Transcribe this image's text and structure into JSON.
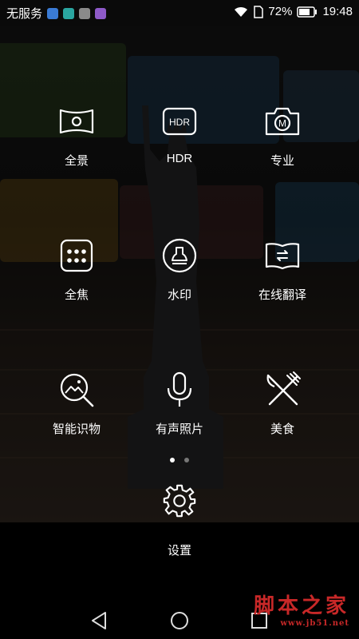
{
  "status_bar": {
    "carrier": "无服务",
    "battery_percent": "72%",
    "time": "19:48",
    "notification_icons": [
      "bluetooth-notif-icon",
      "pen-notif-icon",
      "gallery-notif-icon",
      "media-notif-icon"
    ],
    "icons": [
      "wifi-icon",
      "sim-icon",
      "battery-icon"
    ]
  },
  "modes": [
    {
      "id": "panorama",
      "label": "全景",
      "icon": "panorama-icon"
    },
    {
      "id": "hdr",
      "label": "HDR",
      "icon": "hdr-icon",
      "icon_text": "HDR"
    },
    {
      "id": "pro",
      "label": "专业",
      "icon": "pro-camera-icon",
      "icon_text": "M"
    },
    {
      "id": "allfocus",
      "label": "全焦",
      "icon": "all-focus-icon"
    },
    {
      "id": "watermark",
      "label": "水印",
      "icon": "watermark-icon"
    },
    {
      "id": "translate",
      "label": "在线翻译",
      "icon": "translate-book-icon"
    },
    {
      "id": "recognize",
      "label": "智能识物",
      "icon": "smart-recognize-icon"
    },
    {
      "id": "audio",
      "label": "有声照片",
      "icon": "microphone-icon"
    },
    {
      "id": "food",
      "label": "美食",
      "icon": "fork-knife-icon"
    }
  ],
  "page_indicator": {
    "current": 1,
    "total": 2
  },
  "settings": {
    "label": "设置",
    "icon": "gear-icon"
  },
  "nav": [
    "back-icon",
    "home-icon",
    "recents-icon"
  ],
  "watermark_text": "脚本之家",
  "watermark_url": "www.jb51.net",
  "colors": {
    "accent": "#ffffff",
    "watermark": "#c82828"
  }
}
